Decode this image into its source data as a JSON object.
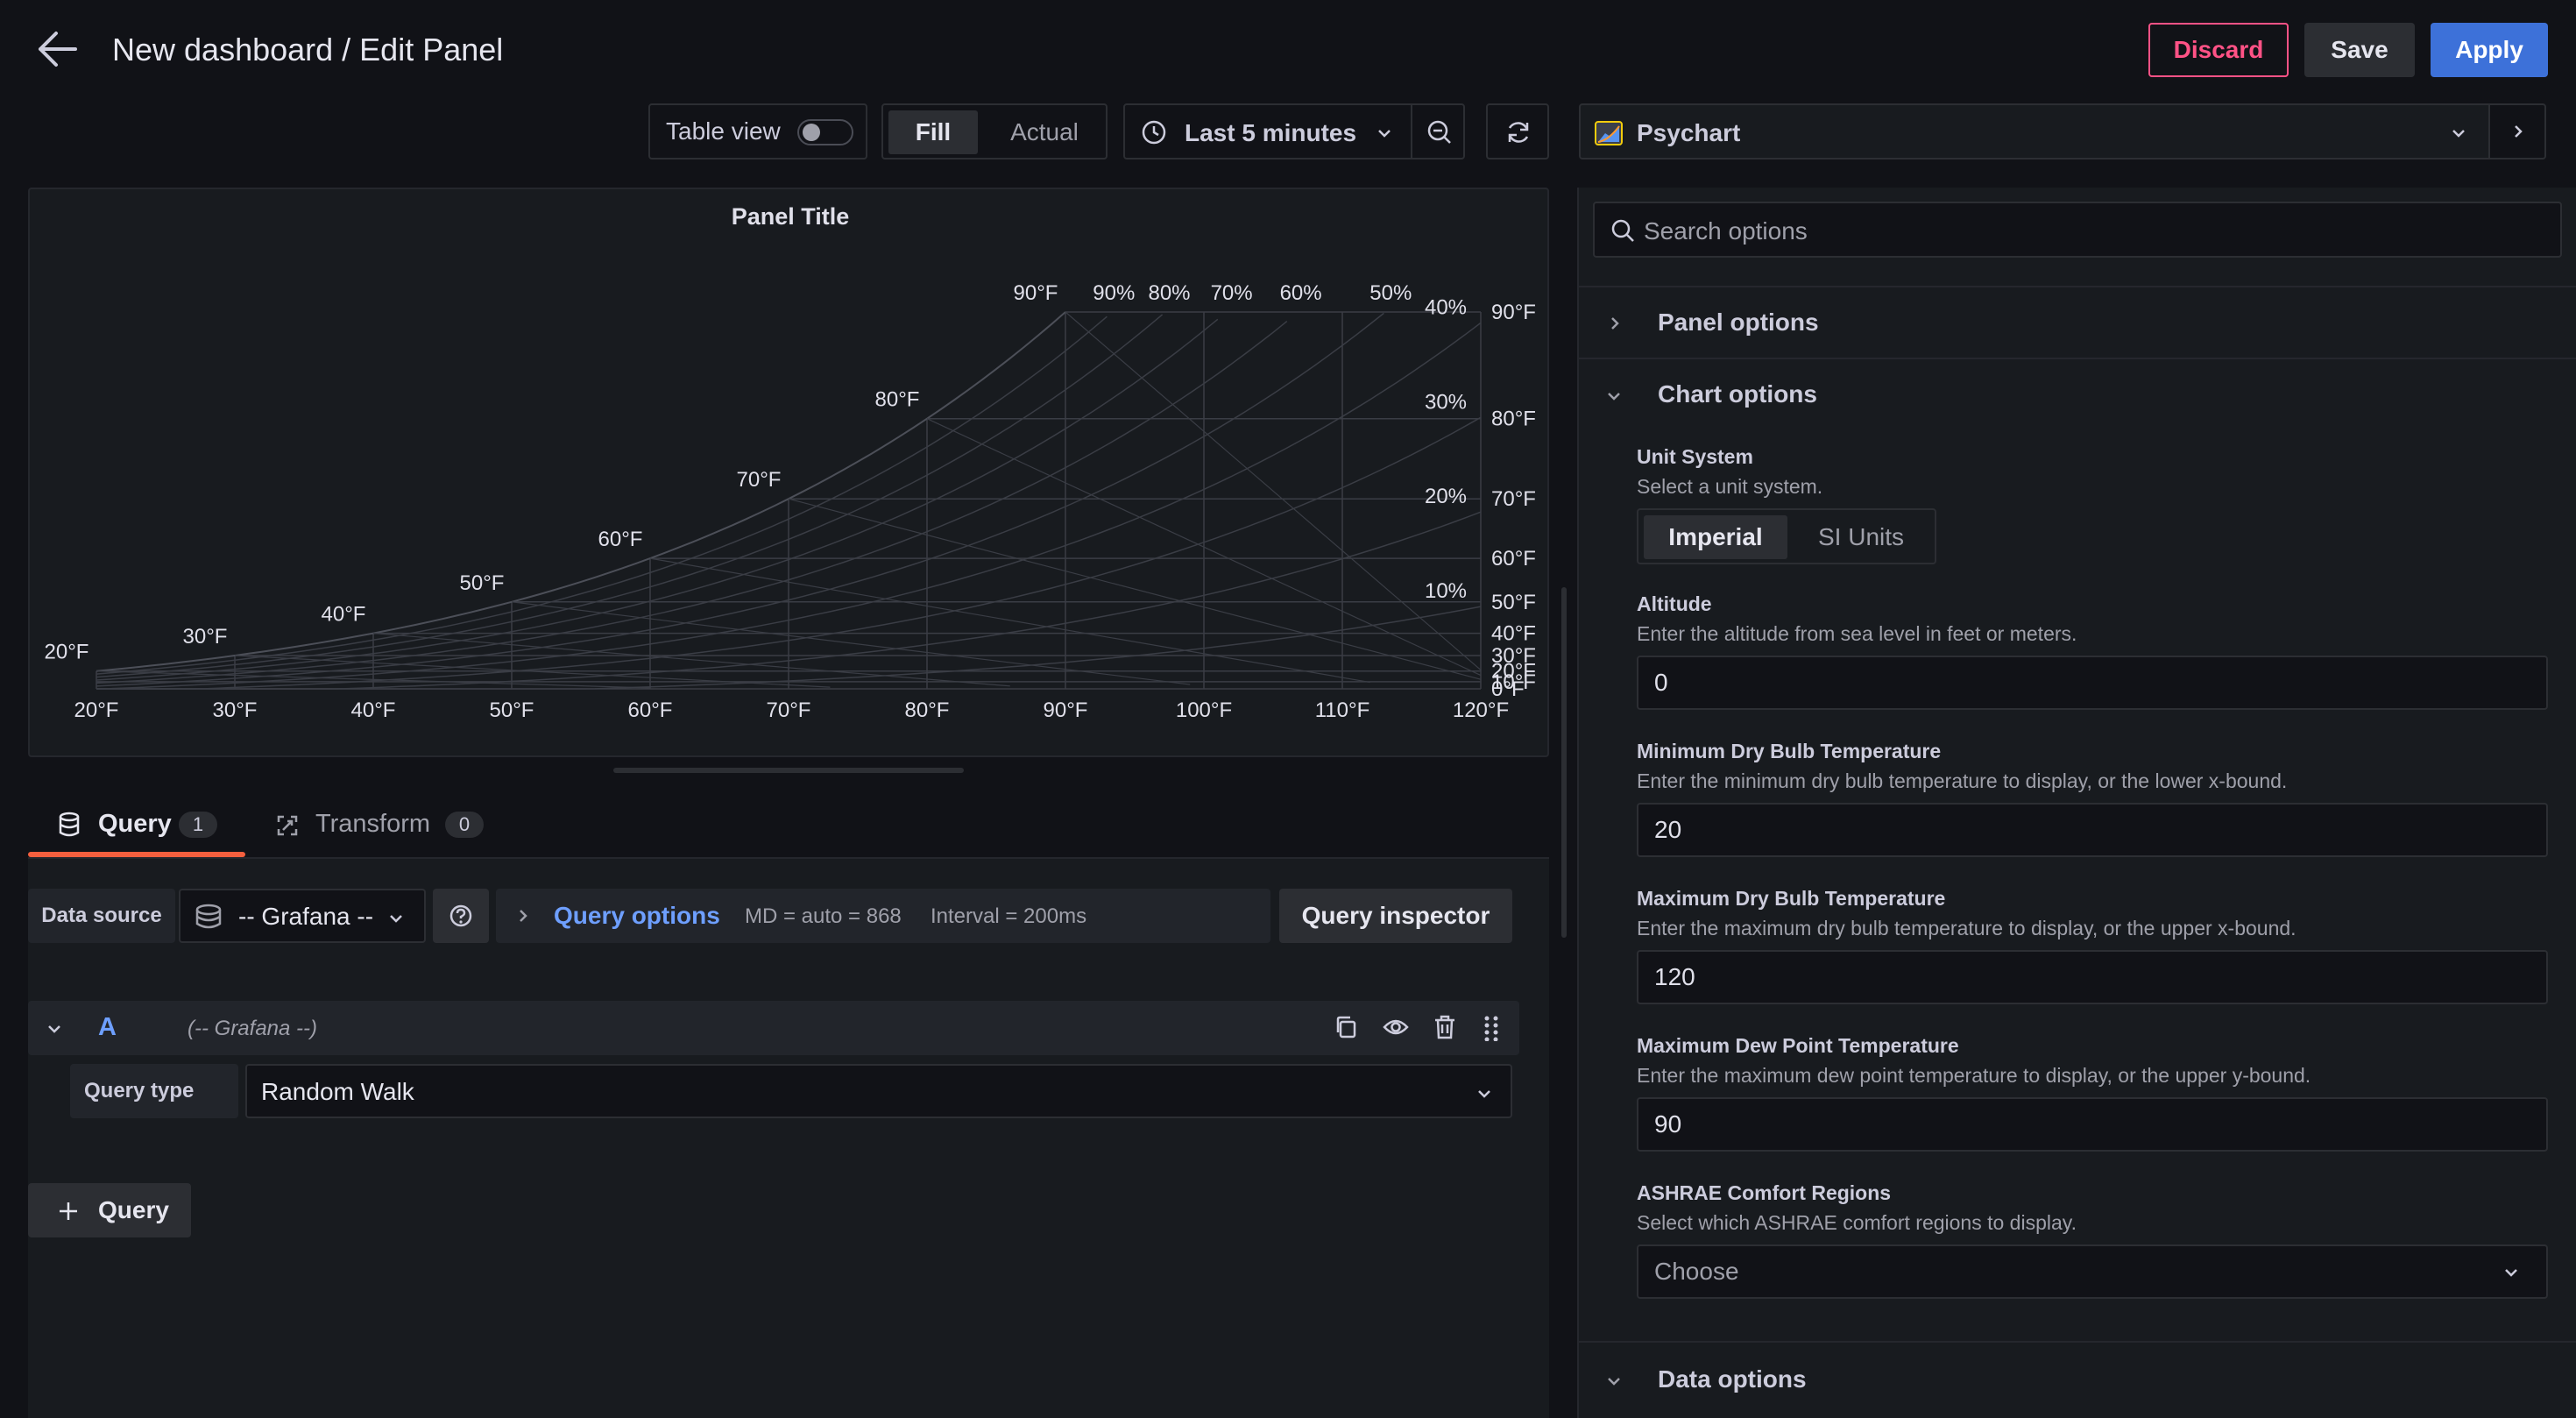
{
  "header": {
    "title": "New dashboard / Edit Panel",
    "discard": "Discard",
    "save": "Save",
    "apply": "Apply"
  },
  "toolbar": {
    "table_view": "Table view",
    "fill": "Fill",
    "actual": "Actual",
    "time_range": "Last 5 minutes",
    "visualization": "Psychart"
  },
  "panel": {
    "title": "Panel Title"
  },
  "chart_data": {
    "type": "psychrometric",
    "title": "Panel Title",
    "x_ticks": [
      "20°F",
      "30°F",
      "40°F",
      "50°F",
      "60°F",
      "70°F",
      "80°F",
      "90°F",
      "100°F",
      "110°F",
      "120°F"
    ],
    "x_range": [
      20,
      120
    ],
    "y_ticks_right": [
      "90°F",
      "80°F",
      "70°F",
      "60°F",
      "50°F",
      "40°F",
      "30°F",
      "20°F",
      "10°F",
      "0°F"
    ],
    "y_range": [
      0,
      90
    ],
    "saturation_labels": [
      "20°F",
      "30°F",
      "40°F",
      "50°F",
      "60°F",
      "70°F",
      "80°F",
      "90°F"
    ],
    "rh_labels": [
      "90%",
      "80%",
      "70%",
      "60%",
      "50%",
      "40%",
      "30%",
      "20%",
      "10%"
    ]
  },
  "query_tabs": {
    "query": "Query",
    "query_count": "1",
    "transform": "Transform",
    "transform_count": "0"
  },
  "datasource": {
    "label": "Data source",
    "value": "-- Grafana --",
    "query_options": "Query options",
    "md": "MD = auto = 868",
    "interval": "Interval = 200ms",
    "inspector": "Query inspector"
  },
  "query_row": {
    "ref_id": "A",
    "source": "(-- Grafana --)",
    "query_type_label": "Query type",
    "query_type_value": "Random Walk",
    "add_query": "Query"
  },
  "options": {
    "search_placeholder": "Search options",
    "panel_options": "Panel options",
    "chart_options": "Chart options",
    "unit_system_label": "Unit System",
    "unit_system_desc": "Select a unit system.",
    "unit_imperial": "Imperial",
    "unit_si": "SI Units",
    "altitude_label": "Altitude",
    "altitude_desc": "Enter the altitude from sea level in feet or meters.",
    "altitude_value": "0",
    "min_db_label": "Minimum Dry Bulb Temperature",
    "min_db_desc": "Enter the minimum dry bulb temperature to display, or the lower x-bound.",
    "min_db_value": "20",
    "max_db_label": "Maximum Dry Bulb Temperature",
    "max_db_desc": "Enter the maximum dry bulb temperature to display, or the upper x-bound.",
    "max_db_value": "120",
    "max_dp_label": "Maximum Dew Point Temperature",
    "max_dp_desc": "Enter the maximum dew point temperature to display, or the upper y-bound.",
    "max_dp_value": "90",
    "ashrae_label": "ASHRAE Comfort Regions",
    "ashrae_desc": "Select which ASHRAE comfort regions to display.",
    "ashrae_value": "Choose",
    "data_options": "Data options"
  },
  "colors": {
    "accent": "#3d71d9",
    "discard": "#ff5286",
    "link": "#6e9fff",
    "active_tab": "#f55f3e"
  }
}
